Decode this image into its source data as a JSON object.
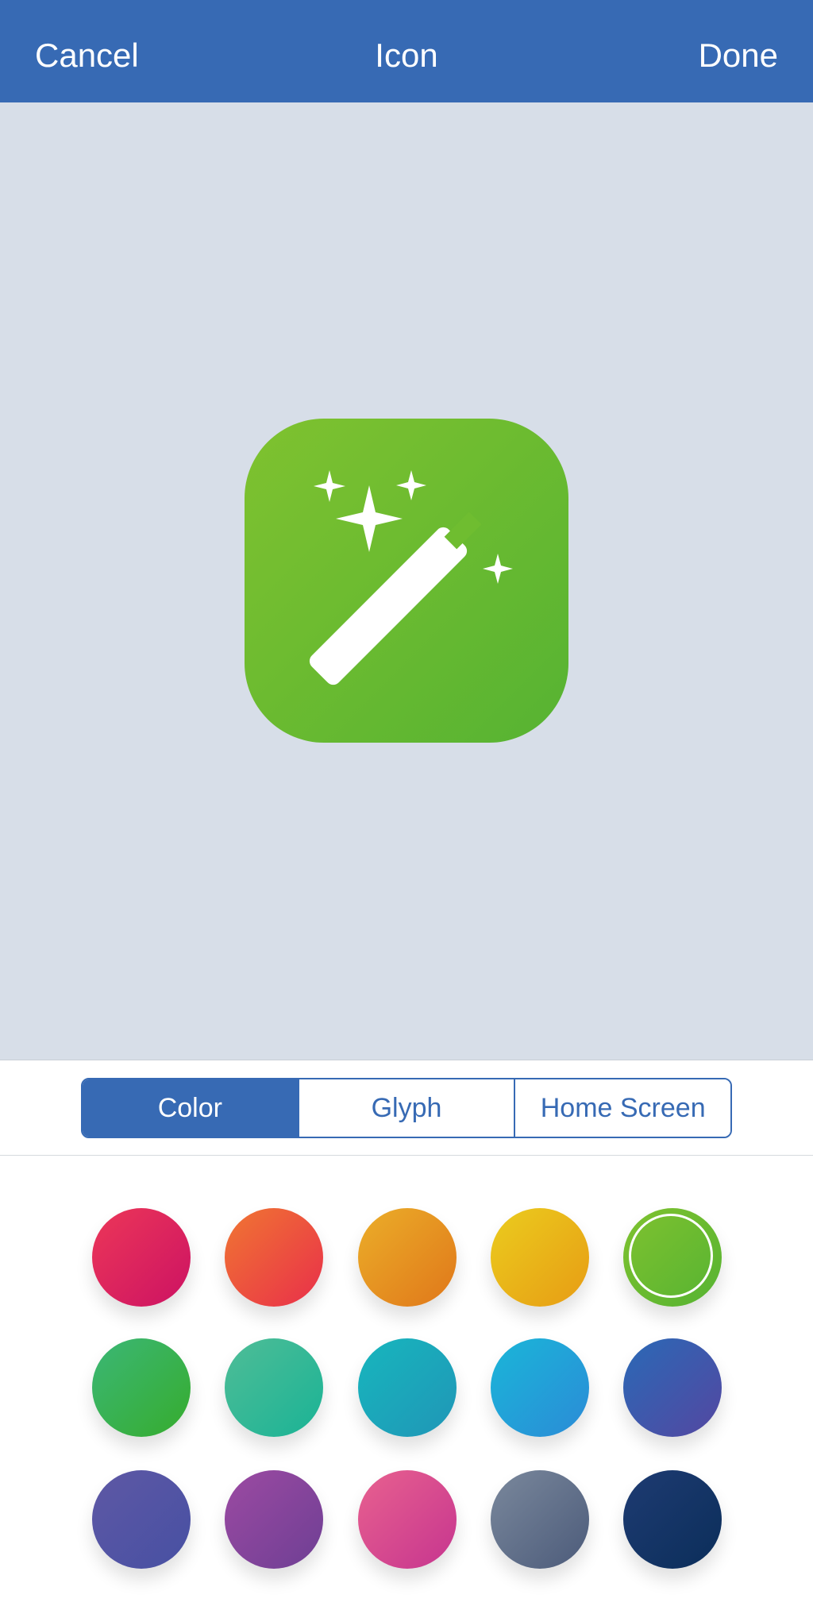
{
  "navbar": {
    "cancel_label": "Cancel",
    "title": "Icon",
    "done_label": "Done",
    "color": "#376ab4"
  },
  "preview": {
    "background": "#d7dee8",
    "icon": {
      "glyph": "magic-wand-icon",
      "gradient": [
        "#7fc22f",
        "#56b332"
      ]
    }
  },
  "segments": {
    "items": [
      "Color",
      "Glyph",
      "Home Screen"
    ],
    "active": "Color"
  },
  "swatches": [
    {
      "name": "red",
      "colors": [
        "#ec3758",
        "#cc1263"
      ],
      "selected": false
    },
    {
      "name": "orange",
      "colors": [
        "#f07632",
        "#e92f4a"
      ],
      "selected": false
    },
    {
      "name": "amber",
      "colors": [
        "#ebae29",
        "#e0771a"
      ],
      "selected": false
    },
    {
      "name": "yellow",
      "colors": [
        "#ebcc1e",
        "#e79c14"
      ],
      "selected": false
    },
    {
      "name": "green",
      "colors": [
        "#7fc22f",
        "#56b332"
      ],
      "selected": true
    },
    {
      "name": "emerald",
      "colors": [
        "#3bb776",
        "#36ac2d"
      ],
      "selected": false
    },
    {
      "name": "teal",
      "colors": [
        "#4fbd97",
        "#1ab395"
      ],
      "selected": false
    },
    {
      "name": "cyan",
      "colors": [
        "#17b6bd",
        "#2096b7"
      ],
      "selected": false
    },
    {
      "name": "sky-blue",
      "colors": [
        "#1ab6d8",
        "#2b8bd7"
      ],
      "selected": false
    },
    {
      "name": "blue",
      "colors": [
        "#2a69b6",
        "#5447a1"
      ],
      "selected": false
    },
    {
      "name": "indigo",
      "colors": [
        "#5e58a4",
        "#4750a3"
      ],
      "selected": false
    },
    {
      "name": "purple",
      "colors": [
        "#9c4aa2",
        "#6e3f94"
      ],
      "selected": false
    },
    {
      "name": "pink",
      "colors": [
        "#e8618f",
        "#c6358f"
      ],
      "selected": false
    },
    {
      "name": "slate",
      "colors": [
        "#7a889c",
        "#4c5b7a"
      ],
      "selected": false
    },
    {
      "name": "navy",
      "colors": [
        "#1e3b72",
        "#0b2e5a"
      ],
      "selected": false
    }
  ]
}
